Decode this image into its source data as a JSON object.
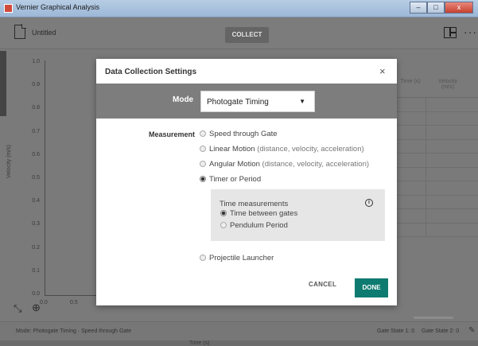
{
  "window": {
    "title": "Vernier Graphical Analysis",
    "minimize": "‒",
    "maximize": "□",
    "close": "x"
  },
  "toolbar": {
    "file_title": "Untitled",
    "collect_label": "COLLECT",
    "more_label": "···"
  },
  "graph": {
    "y_ticks": [
      "1.0",
      "0.9",
      "0.8",
      "0.7",
      "0.6",
      "0.5",
      "0.4",
      "0.3",
      "0.2",
      "0.1",
      "0.0"
    ],
    "x_ticks": [
      "0.0",
      "0.5"
    ],
    "y_label": "Velocity (m/s)",
    "x_label": "Time (s)"
  },
  "table": {
    "col_time": "Time (s)",
    "col_velocity": "Velocity (m/s)"
  },
  "status": {
    "mode_text": "Mode: Photogate Timing · Speed through Gate",
    "gate1": "Gate State 1: 0",
    "gate2": "Gate State 2: 0"
  },
  "dialog": {
    "title": "Data Collection Settings",
    "close": "×",
    "mode_label": "Mode",
    "mode_value": "Photogate Timing",
    "measurement_label": "Measurement",
    "options": [
      {
        "label": "Speed through Gate",
        "detail": "",
        "selected": false
      },
      {
        "label": "Linear Motion",
        "detail": " (distance, velocity, acceleration)",
        "selected": false
      },
      {
        "label": "Angular Motion",
        "detail": " (distance, velocity, acceleration)",
        "selected": false
      },
      {
        "label": "Timer or Period",
        "detail": "",
        "selected": true
      }
    ],
    "time_measurements": {
      "title": "Time measurements",
      "info": "i",
      "options": [
        {
          "label": "Time between gates",
          "selected": true
        },
        {
          "label": "Pendulum Period",
          "selected": false
        }
      ]
    },
    "projectile": {
      "label": "Projectile Launcher",
      "selected": false
    },
    "cancel_label": "CANCEL",
    "done_label": "DONE"
  }
}
